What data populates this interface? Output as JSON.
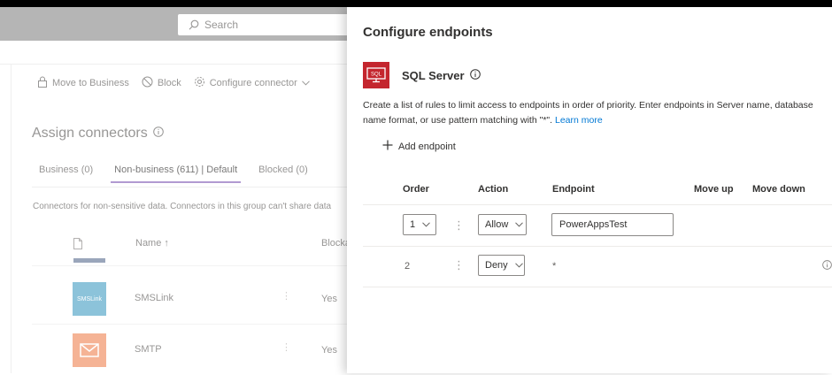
{
  "search": {
    "placeholder": "Search"
  },
  "commandbar": {
    "move_to_business": "Move to Business",
    "block": "Block",
    "configure_connector": "Configure connector"
  },
  "assign": {
    "title": "Assign connectors",
    "tabs": [
      {
        "label": "Business (0)",
        "active": false
      },
      {
        "label": "Non-business (611) | Default",
        "active": true
      },
      {
        "label": "Blocked (0)",
        "active": false
      }
    ],
    "description": "Connectors for non-sensitive data. Connectors in this group can't share data",
    "columns": {
      "name": "Name ↑",
      "blocked": "Blocka"
    },
    "rows": [
      {
        "name": "SMSLink",
        "blocked": "Yes",
        "logo_color": "#4fa3c7",
        "logo_text": "SMSLink"
      },
      {
        "name": "SMTP",
        "blocked": "Yes",
        "logo_color": "#f08a5d",
        "logo_text": ""
      }
    ]
  },
  "panel": {
    "title": "Configure endpoints",
    "connector_name": "SQL Server",
    "connector_logo_text": "SQL",
    "description": "Create a list of rules to limit access to endpoints in order of priority. Enter endpoints in Server name, database name format, or use pattern matching with \"*\".",
    "learn_more": "Learn more",
    "add_endpoint": "Add endpoint",
    "columns": {
      "order": "Order",
      "action": "Action",
      "endpoint": "Endpoint",
      "move_up": "Move up",
      "move_down": "Move down"
    },
    "rules": [
      {
        "order": "1",
        "action": "Allow",
        "endpoint": "PowerAppsTest"
      },
      {
        "order": "2",
        "action": "Deny",
        "endpoint": "*"
      }
    ]
  },
  "colors": {
    "accent": "#8764b8",
    "link": "#0078d4",
    "sql_red": "#c4262e"
  }
}
